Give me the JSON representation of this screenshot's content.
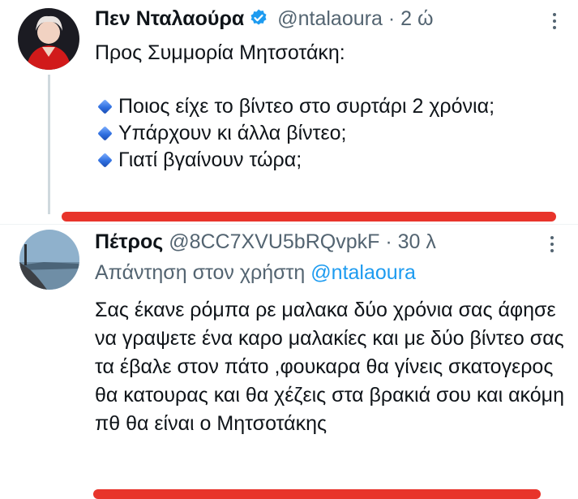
{
  "tweet1": {
    "display_name": "Πεν Νταλαούρα",
    "handle": "@ntalaoura",
    "separator": "·",
    "time": "2 ώ",
    "line1": "Προς Συμμορία Μητσοτάκη:",
    "bullets": [
      "Ποιος είχε το βίντεο στο συρτάρι 2 χρόνια;",
      "Υπάρχουν κι άλλα βίντεο;",
      "Γιατί βγαίνουν τώρα;"
    ]
  },
  "tweet2": {
    "display_name": "Πέτρος",
    "handle": "@8CC7XVU5bRQvpkF",
    "separator": "·",
    "time": "30 λ",
    "reply_prefix": "Απάντηση στον χρήστη",
    "reply_mention": "@ntalaoura",
    "body": "Σας έκανε ρόμπα ρε μαλακα δύο χρόνια σας άφησε να γραψετε ένα καρο μαλακίες και με δύο βίντεο σας τα έβαλε στον πάτο ,φουκαρα θα γίνεις σκατογερος θα κατουρας και θα χέζεις στα βρακιά σου και ακόμη πθ θα είναι ο Μητσοτάκης"
  },
  "icons": {
    "verified": "verified-badge-icon",
    "more": "more-options-icon",
    "bullet": "blue-diamond-icon"
  },
  "colors": {
    "verified_blue": "#1d9bf0",
    "annotation_red": "#e8342b",
    "muted": "#536471"
  }
}
